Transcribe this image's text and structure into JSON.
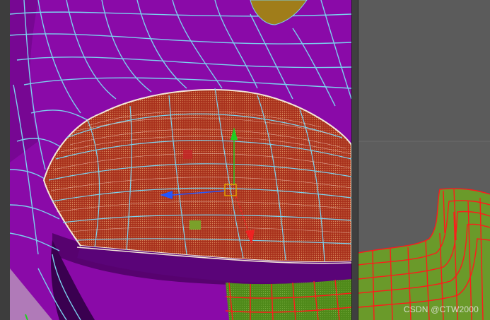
{
  "watermark": {
    "text": "CSDN @CTW2000"
  },
  "colors": {
    "mesh_surface": "#8a0aa8",
    "wire_cyan": "#7ad2ee",
    "selected_face": "#a8301c",
    "gizmo_y": "#22cc22",
    "gizmo_x": "#2255ff",
    "gizmo_z": "#ee2222",
    "gizmo_center": "#e0a000",
    "body_green": "#6a9a2a",
    "wire_red": "#ff1a1a",
    "viewport_gray": "#5d5d5d"
  },
  "icons": {
    "transform_gizmo": "move-gizmo-icon"
  }
}
